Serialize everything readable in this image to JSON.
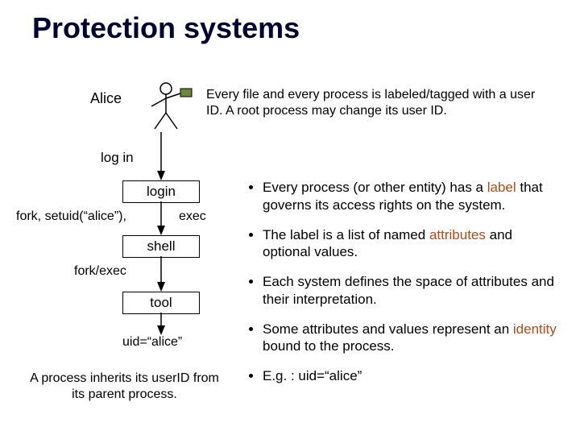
{
  "title": "Protection systems",
  "alice": "Alice",
  "intro": "Every file and every process is labeled/tagged with a user ID.   A root process may change its user ID.",
  "diagram": {
    "login_arrow": "log in",
    "login_box": "login",
    "fork_setuid": "fork, setuid(“alice”),",
    "exec": "exec",
    "shell_box": "shell",
    "forkexec": "fork/exec",
    "tool_box": "tool",
    "uid": "uid=“alice”",
    "inherit": "A process inherits its userID from its parent process."
  },
  "bullets": {
    "b1a": "Every process (or other entity) has a ",
    "b1kw": "label",
    "b1b": " that governs its access rights on the system.",
    "b2a": "The label is a list of named ",
    "b2kw": "attributes",
    "b2b": " and optional values.",
    "b3": "Each system defines the space of attributes and their interpretation.",
    "b4a": "Some attributes and values represent an ",
    "b4kw": "identity",
    "b4b": " bound to the process.",
    "b5": "E.g. : uid=“alice”"
  }
}
